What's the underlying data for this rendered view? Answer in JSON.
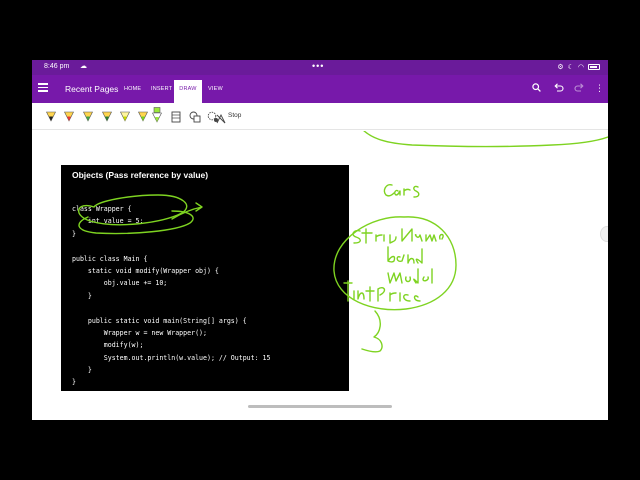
{
  "status_bar": {
    "time": "8:46 pm",
    "cloud_icon": "cloud-icon",
    "dots": "•••",
    "icons": [
      "bluetooth-icon",
      "moon-icon",
      "wifi-icon",
      "battery-icon"
    ]
  },
  "app_bar": {
    "menu_icon": "hamburger-icon",
    "title": "Recent Pages",
    "tabs": [
      {
        "label": "HOME",
        "active": false
      },
      {
        "label": "INSERT",
        "active": false
      },
      {
        "label": "DRAW",
        "active": true
      },
      {
        "label": "VIEW",
        "active": false
      }
    ],
    "actions": [
      "search-icon",
      "undo-icon",
      "redo-icon",
      "more-icon"
    ]
  },
  "toolbar": {
    "pens": [
      {
        "name": "pen-black",
        "color": "#222222"
      },
      {
        "name": "pen-red",
        "color": "#e53935"
      },
      {
        "name": "pen-green",
        "color": "#43a047"
      },
      {
        "name": "pen-dark-green",
        "color": "#2e7d32"
      },
      {
        "name": "highlighter-yellow",
        "color": "#c6d800"
      },
      {
        "name": "pen-lime",
        "color": "#7cd11e"
      },
      {
        "name": "highlighter-green",
        "color": "#9be83a"
      }
    ],
    "tools": [
      "ruler-icon",
      "shapes-icon",
      "lasso-icon"
    ],
    "stop_label": "Stop"
  },
  "code_panel": {
    "title": "Objects (Pass reference by value)",
    "lines": [
      "class Wrapper {",
      "    int value = 5;",
      "}",
      "",
      "public class Main {",
      "    static void modify(Wrapper obj) {",
      "        obj.value += 10;",
      "    }",
      "",
      "    public static void main(String[] args) {",
      "        Wrapper w = new Wrapper();",
      "        modify(w);",
      "        System.out.println(w.value); // Output: 15",
      "    }",
      "}"
    ]
  },
  "ink": {
    "color": "#7ed321",
    "handwriting": [
      "Car S",
      "String Name",
      "band",
      "model",
      "int Price"
    ]
  }
}
